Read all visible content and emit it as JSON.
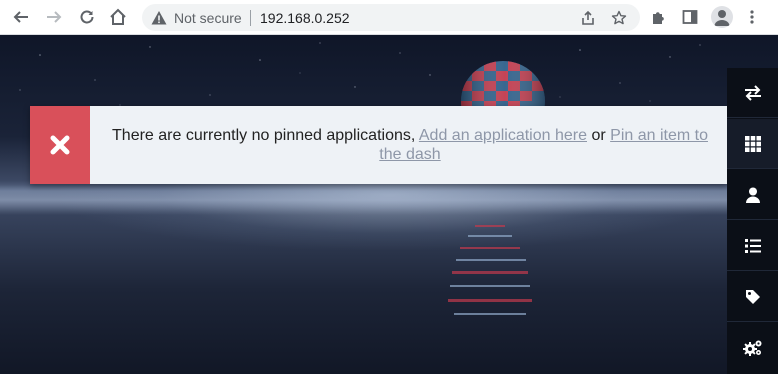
{
  "browser": {
    "security_label": "Not secure",
    "url": "192.168.0.252"
  },
  "banner": {
    "message": "There are currently no pinned applications,",
    "link_add": "Add an application here",
    "conjunction": "or",
    "link_pin": "Pin an item to the dash",
    "close_color": "#d9505a"
  },
  "sidebar": {
    "items": [
      {
        "icon": "swap-arrows-icon"
      },
      {
        "icon": "grid-icon"
      },
      {
        "icon": "user-icon"
      },
      {
        "icon": "list-icon"
      },
      {
        "icon": "tag-icon"
      },
      {
        "icon": "cogs-icon"
      }
    ]
  }
}
